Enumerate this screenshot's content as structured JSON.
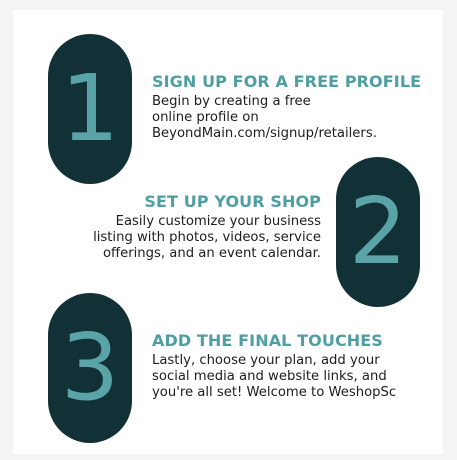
{
  "steps": [
    {
      "number": "1",
      "title": "SIGN UP FOR A FREE PROFILE",
      "description": "Begin by creating a free\nonline profile on\nBeyondMain.com/signup/retailers."
    },
    {
      "number": "2",
      "title": "SET UP YOUR SHOP",
      "description": "Easily customize your business\nlisting with photos, videos, service\nofferings, and an event calendar."
    },
    {
      "number": "3",
      "title": "ADD THE FINAL TOUCHES",
      "description": "Lastly, choose your plan, add your\nsocial media and website links, and\nyou're all set! Welcome to WeshopSc"
    }
  ],
  "colors": {
    "pill": "#123136",
    "accent": "#5aa3a6",
    "text": "#1d1d1d",
    "background": "#ffffff"
  }
}
